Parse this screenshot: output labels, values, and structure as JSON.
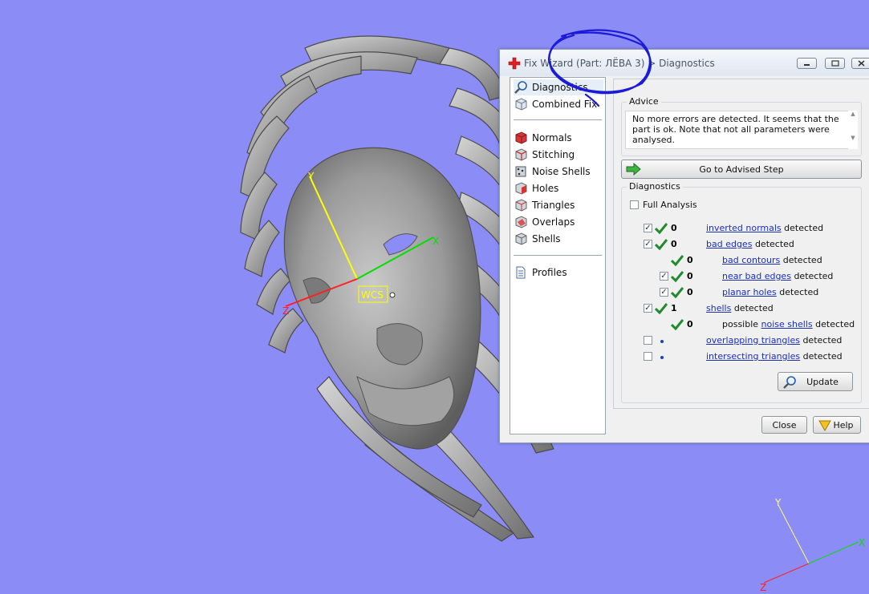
{
  "viewport": {
    "background": "#8c8cf6",
    "wcs_label": "WCS",
    "axis_labels": {
      "x": "X",
      "y": "Y",
      "z": "Z"
    },
    "corner_axis_labels": {
      "y": "Y",
      "z": "Z",
      "x": "X"
    }
  },
  "dialog": {
    "title": "Fix Wizard (Part: ЛЁВА 3) > Diagnostics",
    "title_icon": "red-cross-icon",
    "window_buttons": [
      "minimize",
      "restore",
      "close"
    ]
  },
  "nav": {
    "top_items": [
      {
        "label": "Diagnostics",
        "icon": "magnifier-icon"
      },
      {
        "label": "Combined Fix",
        "icon": "cube-icon"
      }
    ],
    "fix_items": [
      {
        "label": "Normals",
        "icon": "normals-icon"
      },
      {
        "label": "Stitching",
        "icon": "stitching-icon"
      },
      {
        "label": "Noise Shells",
        "icon": "noise-shells-icon"
      },
      {
        "label": "Holes",
        "icon": "holes-icon"
      },
      {
        "label": "Triangles",
        "icon": "triangles-icon"
      },
      {
        "label": "Overlaps",
        "icon": "overlaps-icon"
      },
      {
        "label": "Shells",
        "icon": "shells-icon"
      }
    ],
    "profiles": {
      "label": "Profiles",
      "icon": "document-icon"
    }
  },
  "advice": {
    "title": "Advice",
    "text": "No more errors are detected. It seems that the part is ok. Note that not all parameters were analysed."
  },
  "go_advised_label": "Go to Advised Step",
  "diagnostics": {
    "title": "Diagnostics",
    "full_analysis_label": "Full Analysis",
    "rows": [
      {
        "checked": true,
        "status": "ok",
        "count": "0",
        "prefix": "",
        "link": "inverted normals",
        "suffix": "detected"
      },
      {
        "checked": true,
        "status": "ok",
        "count": "0",
        "prefix": "",
        "link": "bad edges",
        "suffix": "detected"
      },
      {
        "checked": null,
        "status": "ok",
        "count": "0",
        "prefix": "",
        "link": "bad contours",
        "suffix": "detected"
      },
      {
        "checked": true,
        "status": "ok",
        "count": "0",
        "prefix": "",
        "link": "near bad edges",
        "suffix": "detected"
      },
      {
        "checked": true,
        "status": "ok",
        "count": "0",
        "prefix": "",
        "link": "planar holes",
        "suffix": "detected"
      },
      {
        "checked": true,
        "status": "ok",
        "count": "1",
        "prefix": "",
        "link": "shells",
        "suffix": "detected"
      },
      {
        "checked": null,
        "status": "ok",
        "count": "0",
        "prefix": "possible",
        "link": "noise shells",
        "suffix": "detected"
      },
      {
        "checked": false,
        "status": "pending",
        "count": "",
        "prefix": "",
        "link": "overlapping triangles",
        "suffix": "detected"
      },
      {
        "checked": false,
        "status": "pending",
        "count": "",
        "prefix": "",
        "link": "intersecting triangles",
        "suffix": "detected"
      }
    ],
    "update_label": "Update"
  },
  "footer": {
    "close_label": "Close",
    "help_label": "Help"
  },
  "colors": {
    "link": "#1a2fb8",
    "check_green": "#1f8a2e",
    "dot_blue": "#1a3ec8"
  }
}
